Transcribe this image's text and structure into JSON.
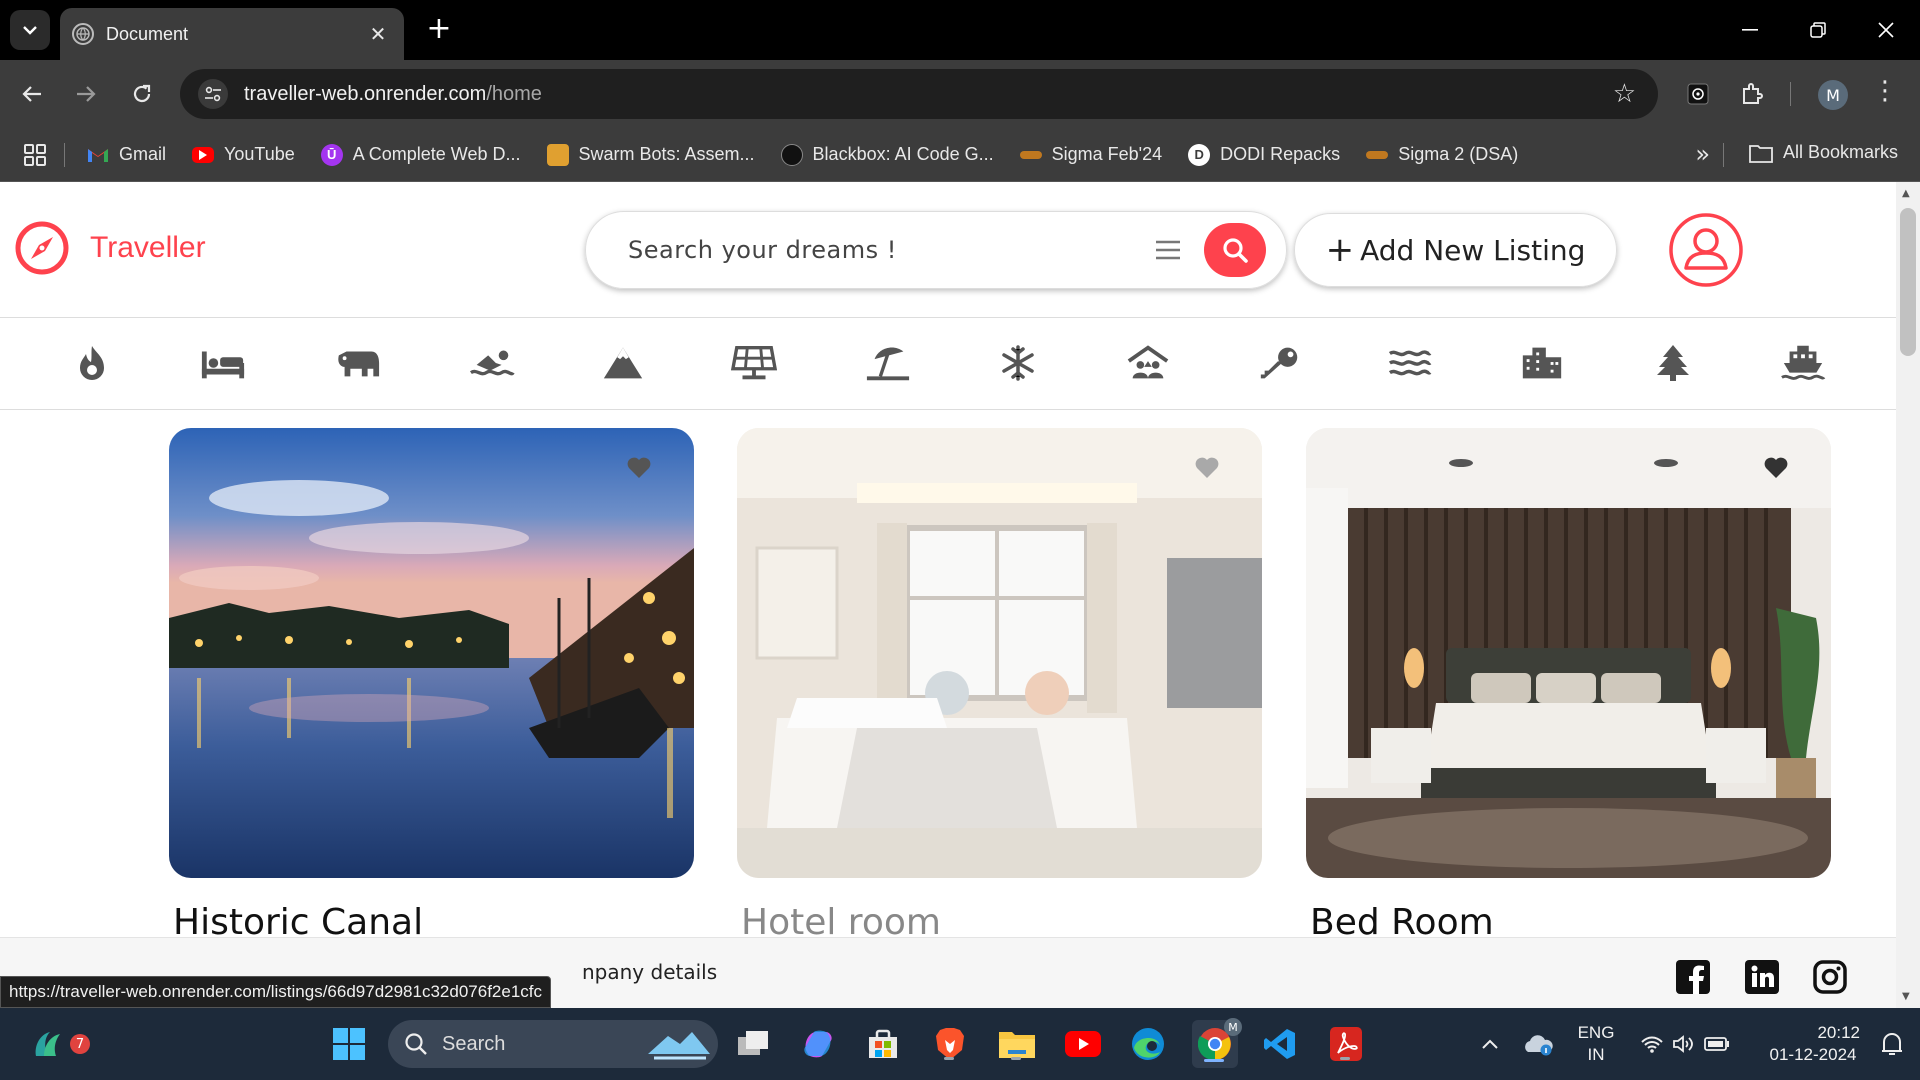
{
  "browser": {
    "tab_title": "Document",
    "url_host": "traveller-web.onrender.com",
    "url_path": "/home",
    "profile_initial": "M",
    "bookmarks": [
      {
        "label": "Gmail",
        "icon": "gmail-icon",
        "color": "#ea4335"
      },
      {
        "label": "YouTube",
        "icon": "youtube-icon",
        "color": "#ff0000"
      },
      {
        "label": "A Complete Web D...",
        "icon": "udemy-icon",
        "color": "#a435f0"
      },
      {
        "label": "Swarm Bots: Assem...",
        "icon": "swarm-icon",
        "color": "#e0a030"
      },
      {
        "label": "Blackbox: AI Code G...",
        "icon": "blackbox-icon",
        "color": "#111111"
      },
      {
        "label": "Sigma Feb'24",
        "icon": "sigma-icon",
        "color": "#c0781f"
      },
      {
        "label": "DODI Repacks",
        "icon": "dodi-icon",
        "color": "#ffffff"
      },
      {
        "label": "Sigma 2 (DSA)",
        "icon": "sigma-icon",
        "color": "#c0781f"
      }
    ],
    "all_bookmarks": "All Bookmarks",
    "status_url": "https://traveller-web.onrender.com/listings/66d97d2981c32d076f2e1cfc"
  },
  "site": {
    "brand": "Traveller",
    "brand_color": "#fe424d",
    "search_placeholder": "Search your dreams !",
    "add_listing": "Add New Listing",
    "filters": [
      "trending",
      "rooms",
      "farms",
      "pools",
      "mountains",
      "solar",
      "beach",
      "arctic",
      "camping",
      "castle",
      "lake",
      "cities",
      "forest",
      "boats"
    ],
    "listings": [
      {
        "title": "Historic Canal"
      },
      {
        "title": "Hotel room"
      },
      {
        "title": "Bed Room"
      }
    ],
    "footer_text": "npany details",
    "socials": [
      "facebook-icon",
      "linkedin-icon",
      "instagram-icon"
    ]
  },
  "taskbar": {
    "search": "Search",
    "weather_badge": "7",
    "lang_line1": "ENG",
    "lang_line2": "IN",
    "time": "20:12",
    "date": "01-12-2024"
  }
}
